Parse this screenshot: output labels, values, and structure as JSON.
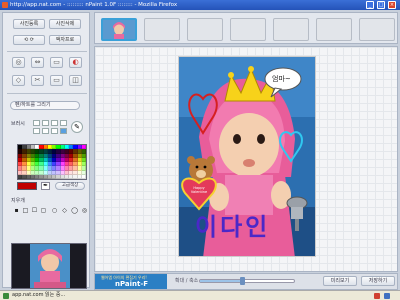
{
  "window": {
    "title": "http://app.nat.com - ::::::::: nPaint 1.0F :::::::: - Mozilla Firefox"
  },
  "toolbar": {
    "top_buttons": [
      "사진등록",
      "사진삭제",
      "",
      "액자프로"
    ]
  },
  "tools": {
    "pen_label": "펜/하트를 그리기",
    "brush_label": "브러시",
    "advanced_color": "고급색상",
    "shape_label": "지우개"
  },
  "palette_colors": [
    "#000000",
    "#3f3f3f",
    "#7f7f7f",
    "#bfbfbf",
    "#ffffff",
    "#ff0000",
    "#ff7f00",
    "#ffff00",
    "#7fff00",
    "#00ff00",
    "#00ff7f",
    "#00ffff",
    "#007fff",
    "#0000ff",
    "#7f00ff",
    "#ff00ff",
    "#200000",
    "#402000",
    "#404000",
    "#204000",
    "#004000",
    "#004020",
    "#004040",
    "#002040",
    "#000040",
    "#200040",
    "#400040",
    "#400020",
    "#600000",
    "#603000",
    "#606000",
    "#306000",
    "#800000",
    "#804000",
    "#808000",
    "#408000",
    "#008000",
    "#008040",
    "#008080",
    "#004080",
    "#000080",
    "#400080",
    "#800080",
    "#800040",
    "#a00000",
    "#a05000",
    "#a0a000",
    "#50a000",
    "#c00000",
    "#c06000",
    "#c0c000",
    "#60c000",
    "#00c000",
    "#00c060",
    "#00c0c0",
    "#0060c0",
    "#0000c0",
    "#6000c0",
    "#c000c0",
    "#c00060",
    "#e02020",
    "#e07020",
    "#e0e020",
    "#70e020",
    "#ff4040",
    "#ff9040",
    "#ffff40",
    "#90ff40",
    "#40ff40",
    "#40ff90",
    "#40ffff",
    "#4090ff",
    "#4040ff",
    "#9040ff",
    "#ff40ff",
    "#ff4090",
    "#ff6060",
    "#ffa060",
    "#ffff60",
    "#a0ff60",
    "#ff8080",
    "#ffb080",
    "#ffff80",
    "#b0ff80",
    "#80ff80",
    "#80ffb0",
    "#80ffff",
    "#80b0ff",
    "#8080ff",
    "#b080ff",
    "#ff80ff",
    "#ff80b0",
    "#ffa0a0",
    "#ffc0a0",
    "#ffffa0",
    "#c0ffa0",
    "#ffc0c0",
    "#ffd0c0",
    "#ffffc0",
    "#d0ffc0",
    "#c0ffc0",
    "#c0ffd0",
    "#c0ffff",
    "#c0d0ff",
    "#c0c0ff",
    "#d0c0ff",
    "#ffc0ff",
    "#ffc0d0",
    "#ffe0e0",
    "#ffe8e0",
    "#ffffe0",
    "#e8ffe0",
    "#404040",
    "#505050",
    "#606060",
    "#707070",
    "#808080",
    "#909090",
    "#a0a0a0",
    "#b0b0b0",
    "#c0c0c0",
    "#d0d0d0",
    "#e0e0e0",
    "#e8e8e8",
    "#f0f0f0",
    "#f4f4f4",
    "#f8f8f8",
    "#ffffff"
  ],
  "current_color": "#c00000",
  "canvas": {
    "speech_text": "엄마~",
    "name_text": "이다인",
    "valentine_text": "Happy Valentine"
  },
  "bottom": {
    "brand_tagline": "웹어엠 아이의 편집기 우리!",
    "brand_name": "nPaint-F",
    "zoom_label": "확대 / 축소",
    "zoom_level": 0.45,
    "preview_button": "미리보기",
    "save_button": "저장하기"
  },
  "statusbar": {
    "text": "app.nat.com 읽는 중..."
  }
}
